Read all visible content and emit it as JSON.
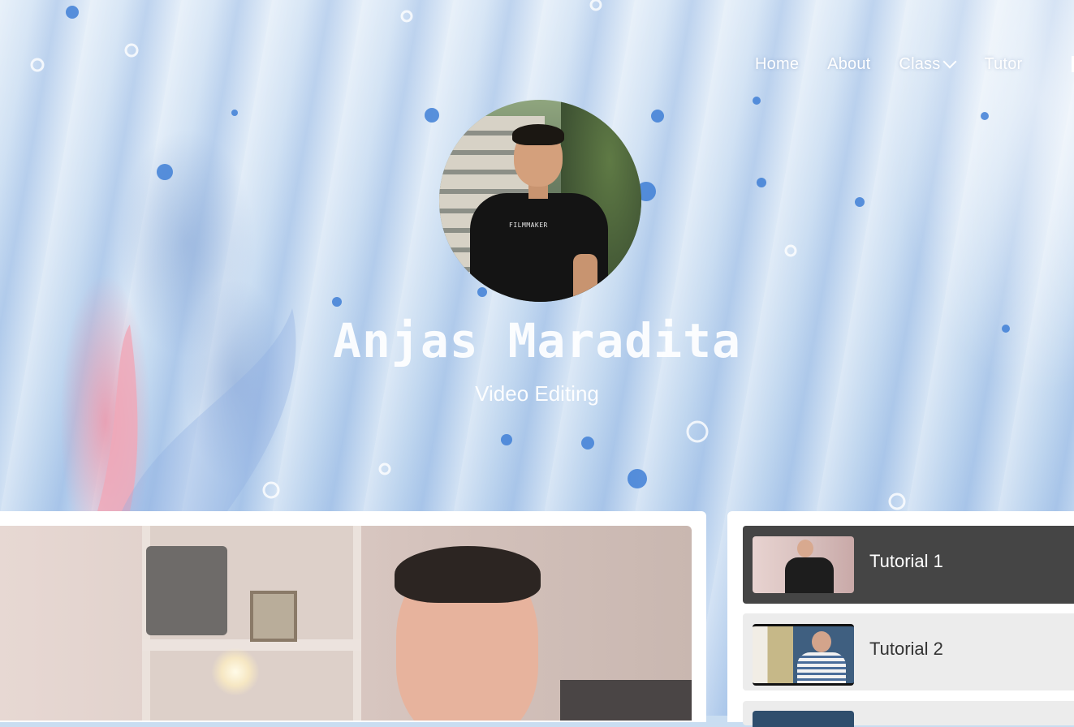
{
  "nav": {
    "items": [
      "Home",
      "About",
      "Class",
      "Tutor"
    ]
  },
  "profile": {
    "name": "Anjas Maradita",
    "subtitle": "Video Editing",
    "shirt_text": "FILMMAKER"
  },
  "playlist": {
    "items": [
      {
        "title": "Tutorial 1",
        "active": true
      },
      {
        "title": "Tutorial 2",
        "active": false
      }
    ]
  },
  "colors": {
    "accent_active": "#454545",
    "item_bg": "#ececec",
    "text_light": "#ffffff"
  },
  "icons": [
    "chevron-down-icon"
  ]
}
